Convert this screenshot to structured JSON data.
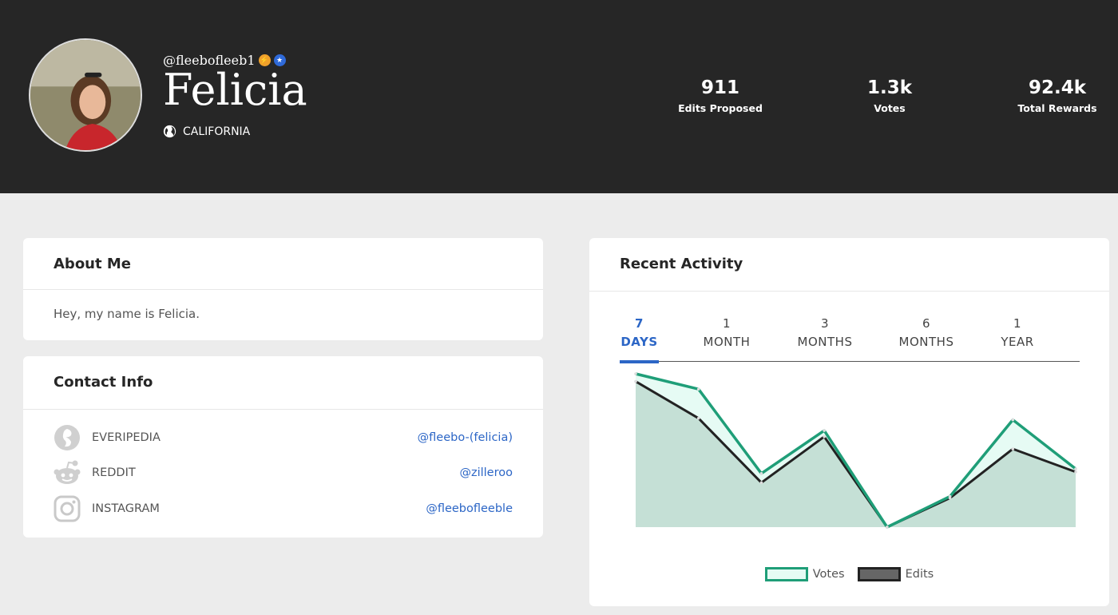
{
  "profile": {
    "handle": "@fleebofleeb1",
    "name": "Felicia",
    "location": "CALIFORNIA"
  },
  "stats": [
    {
      "value": "911",
      "label": "Edits Proposed"
    },
    {
      "value": "1.3k",
      "label": "Votes"
    },
    {
      "value": "92.4k",
      "label": "Total Rewards"
    }
  ],
  "about": {
    "title": "About Me",
    "body": "Hey, my name is Felicia."
  },
  "contact": {
    "title": "Contact Info",
    "items": [
      {
        "name": "EVERIPEDIA",
        "link": "@fleebo-(felicia)",
        "icon": "everipedia-icon"
      },
      {
        "name": "REDDIT",
        "link": "@zilleroo",
        "icon": "reddit-icon"
      },
      {
        "name": "INSTAGRAM",
        "link": "@fleebofleeble",
        "icon": "instagram-icon"
      }
    ]
  },
  "activity": {
    "title": "Recent Activity",
    "tabs": [
      {
        "top": "7",
        "bottom": "DAYS"
      },
      {
        "top": "1",
        "bottom": "MONTH"
      },
      {
        "top": "3",
        "bottom": "MONTHS"
      },
      {
        "top": "6",
        "bottom": "MONTHS"
      },
      {
        "top": "1",
        "bottom": "YEAR"
      }
    ],
    "active_tab": "7 DAYS"
  },
  "colors": {
    "header_bg": "#262626",
    "accent_blue": "#2c66c6",
    "votes": "#1f9e78",
    "votes_fill": "#e6fbf4",
    "edits": "#222222",
    "edits_fill": "#c5e0d6"
  },
  "chart_data": {
    "type": "area",
    "x": [
      1,
      2,
      3,
      4,
      5,
      6,
      7,
      8
    ],
    "series": [
      {
        "name": "Votes",
        "values": [
          100,
          90,
          35,
          63,
          0,
          20,
          70,
          38
        ]
      },
      {
        "name": "Edits",
        "values": [
          95,
          71,
          29,
          59,
          0,
          19,
          51,
          36
        ]
      }
    ],
    "ylim": [
      0,
      100
    ],
    "legend": "bottom",
    "grid": false
  }
}
